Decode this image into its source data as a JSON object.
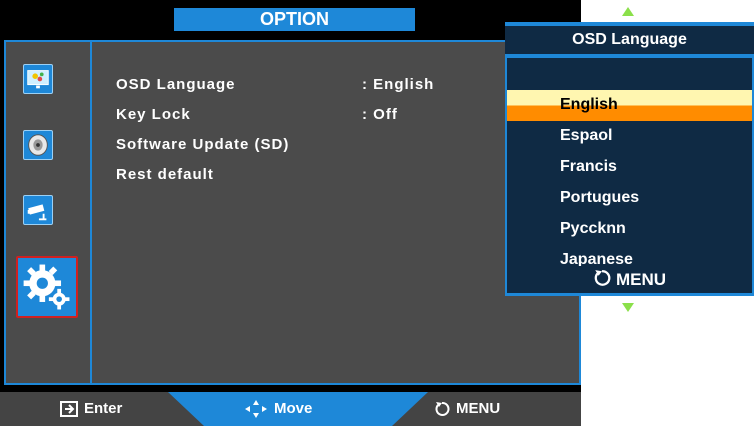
{
  "header": {
    "title": "OPTION"
  },
  "sidebar": {
    "icons": [
      {
        "name": "picture-icon"
      },
      {
        "name": "audio-icon"
      },
      {
        "name": "camera-icon"
      },
      {
        "name": "settings-gears-icon"
      }
    ]
  },
  "menu": {
    "items": [
      {
        "label": "OSD Language",
        "value": ": English"
      },
      {
        "label": "Key Lock",
        "value": ": Off"
      },
      {
        "label": "Software Update (SD)",
        "value": ""
      },
      {
        "label": "Rest default",
        "value": ""
      }
    ]
  },
  "footer": {
    "enter_label": "Enter",
    "move_label": "Move",
    "menu_label": "MENU"
  },
  "popup": {
    "title": "OSD Language",
    "selected": "English",
    "items": [
      "English",
      "Espaol",
      "Francis",
      "Portugues",
      "Pyccknn",
      "Japanese"
    ],
    "footer_label": "MENU"
  },
  "colors": {
    "accent": "#1e88d8",
    "panel": "#4b4b4b",
    "highlight_top": "#fff6b0",
    "highlight_bottom": "#ff8c00",
    "scroll_arrow": "#8be04a"
  }
}
